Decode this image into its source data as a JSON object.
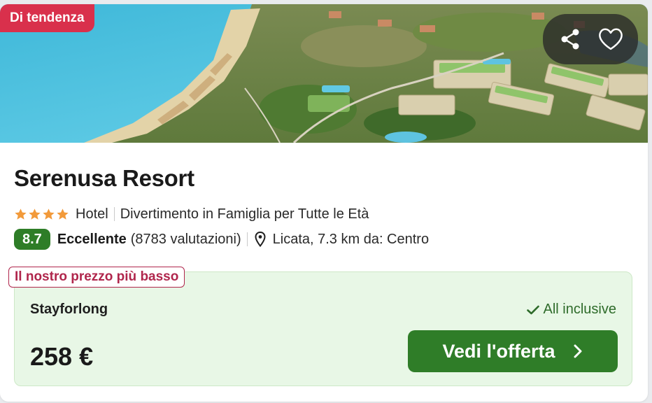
{
  "badge": {
    "trending": "Di tendenza"
  },
  "hotel": {
    "name": "Serenusa Resort",
    "star_count": 4,
    "type": "Hotel",
    "theme": "Divertimento in Famiglia per Tutte le Età",
    "score": "8.7",
    "rating_word": "Eccellente",
    "reviews": "(8783 valutazioni)",
    "location": "Licata, 7.3 km da: Centro"
  },
  "deal": {
    "badge": "Il nostro prezzo più basso",
    "provider": "Stayforlong",
    "board": "All inclusive",
    "price": "258 €",
    "cta": "Vedi l'offerta"
  },
  "icons": {
    "share": "share-icon",
    "favorite": "heart-icon",
    "star": "star-icon",
    "pin": "map-pin-icon",
    "check": "check-icon",
    "chevron": "chevron-right-icon"
  },
  "colors": {
    "trend_badge": "#d9304c",
    "score_badge": "#2e7d27",
    "cta": "#2f7d28",
    "star": "#f29a3a",
    "price_box_bg": "#e8f7e6",
    "lowest_badge": "#b0264c"
  }
}
